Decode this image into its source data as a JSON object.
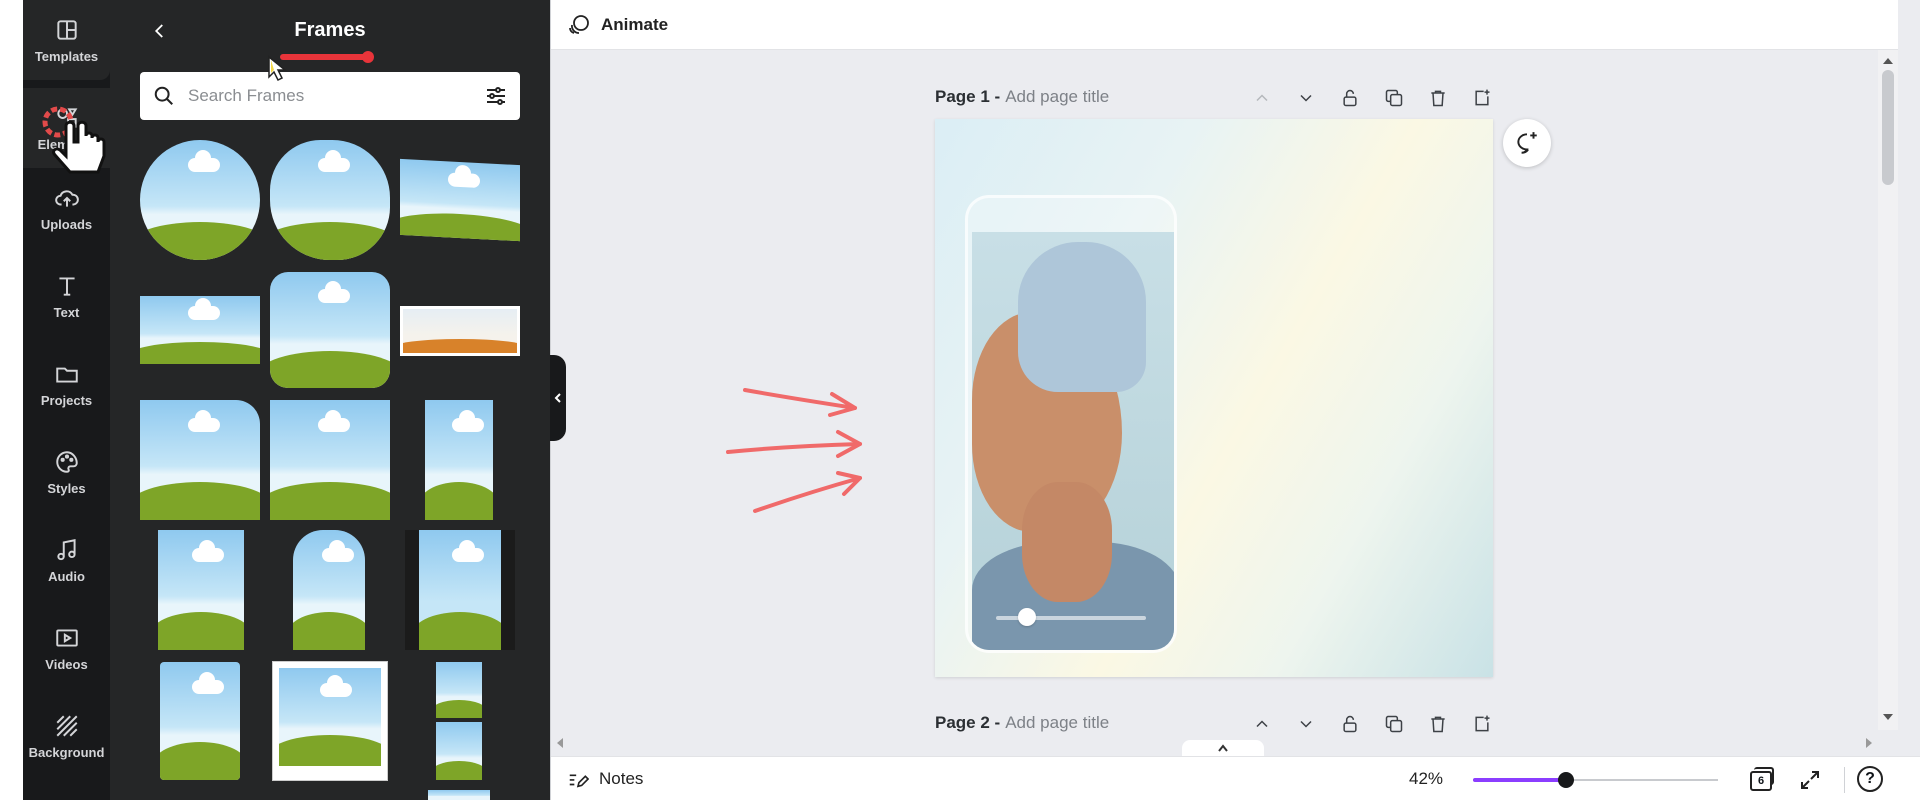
{
  "rail": {
    "items": [
      {
        "label": "Templates",
        "icon": "templates-icon"
      },
      {
        "label": "Elements",
        "icon": "elements-icon"
      },
      {
        "label": "Uploads",
        "icon": "upload-cloud-icon"
      },
      {
        "label": "Text",
        "icon": "text-icon"
      },
      {
        "label": "Projects",
        "icon": "folder-icon"
      },
      {
        "label": "Styles",
        "icon": "palette-icon"
      },
      {
        "label": "Audio",
        "icon": "music-note-icon"
      },
      {
        "label": "Videos",
        "icon": "video-icon"
      },
      {
        "label": "Background",
        "icon": "background-hatch-icon"
      }
    ]
  },
  "panel": {
    "title": "Frames",
    "search_placeholder": "Search Frames"
  },
  "topbar": {
    "animate_label": "Animate"
  },
  "pages": [
    {
      "name": "Page 1 -",
      "title_placeholder": "Add page title"
    },
    {
      "name": "Page 2 -",
      "title_placeholder": "Add page title"
    }
  ],
  "bottombar": {
    "notes_label": "Notes",
    "zoom": "42%",
    "zoom_fraction": 0.38,
    "page_count": "6",
    "help": "?"
  },
  "colors": {
    "accent": "#8b3dff",
    "annotation_red": "#f06a6a",
    "dark_panel": "#252627"
  }
}
